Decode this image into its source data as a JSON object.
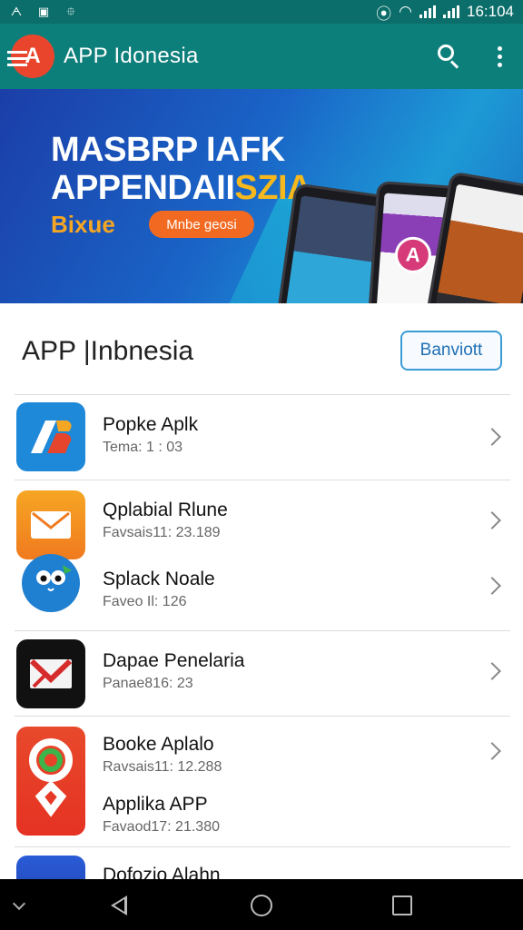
{
  "status_bar": {
    "time": "16:104",
    "icons": [
      "notification-a-icon",
      "news-icon",
      "usb-icon",
      "vibrate-icon",
      "wifi-icon",
      "signal-icon",
      "signal-icon-2"
    ]
  },
  "app_bar": {
    "title": "APP Idonesia",
    "logo_letter": "A",
    "color": "#0d7f7a"
  },
  "banner": {
    "headline_1": "MASBRP IAFK",
    "headline_2": "APPENDAIISZIA",
    "subtitle": "Bixue",
    "cta_label": "Mnbe geosi",
    "phone_badge": "A"
  },
  "section": {
    "title": "APP |Inbnesia",
    "button_label": "Banviott"
  },
  "apps": [
    {
      "name": "Popke Aplk",
      "meta": "Tema: 1 : 03"
    },
    {
      "name": "Qplabial Rlune",
      "meta": "Favsais11: 23.189"
    },
    {
      "name": "Splack Noale",
      "meta": "Faveo Il: 126"
    },
    {
      "name": "Dapae Penelaria",
      "meta": "Panae816: 23"
    },
    {
      "name": "Booke Aplalo",
      "meta": "Ravsais11: 12.288"
    },
    {
      "name": "Applika APP",
      "meta": "Favaod17: 21.380"
    },
    {
      "name": "Dofozio Alahn",
      "meta": ""
    }
  ],
  "colors": {
    "accent": "#0d7f7a",
    "logo": "#e9452d",
    "button_border": "#3a9bd5"
  }
}
